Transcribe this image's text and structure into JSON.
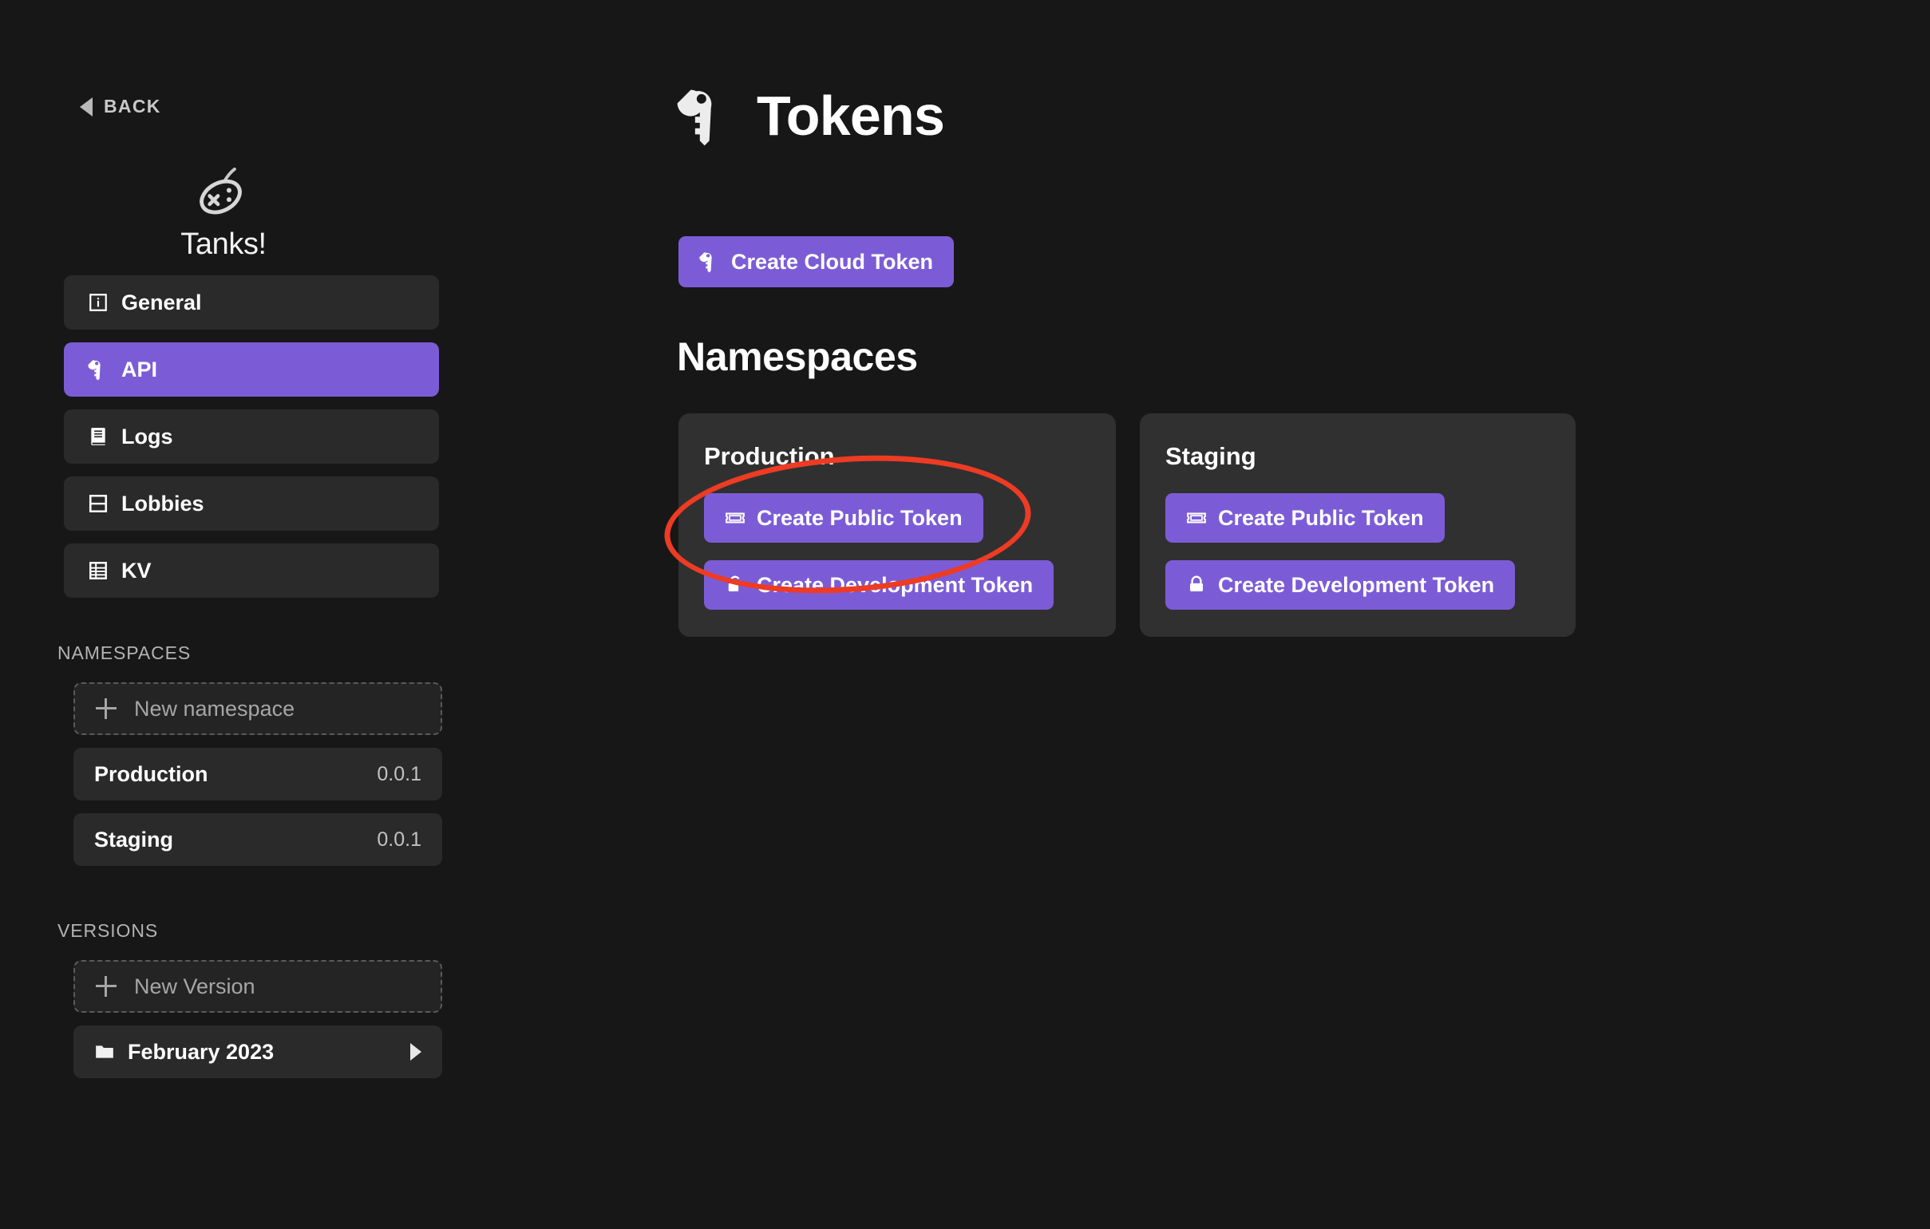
{
  "sidebar": {
    "back_label": "BACK",
    "back_icon": "triangle-left-icon",
    "game": {
      "name": "Tanks!",
      "icon": "gamepad-icon"
    },
    "nav": [
      {
        "label": "General",
        "icon": "info-square-icon",
        "active": false
      },
      {
        "label": "API",
        "icon": "key-icon",
        "active": true
      },
      {
        "label": "Logs",
        "icon": "book-icon",
        "active": false
      },
      {
        "label": "Lobbies",
        "icon": "window-icon",
        "active": false
      },
      {
        "label": "KV",
        "icon": "table-icon",
        "active": false
      }
    ],
    "namespaces": {
      "heading": "NAMESPACES",
      "new_label": "New namespace",
      "new_icon": "plus-icon",
      "items": [
        {
          "name": "Production",
          "version": "0.0.1"
        },
        {
          "name": "Staging",
          "version": "0.0.1"
        }
      ]
    },
    "versions": {
      "heading": "VERSIONS",
      "new_label": "New Version",
      "new_icon": "plus-icon",
      "items": [
        {
          "name": "February 2023",
          "icon": "folder-icon",
          "chevron": "chevron-right-icon"
        }
      ]
    }
  },
  "main": {
    "title": "Tokens",
    "title_icon": "key-icon",
    "cloud_token_button": {
      "label": "Create Cloud Token",
      "icon": "key-icon"
    },
    "namespaces_heading": "Namespaces",
    "cards": [
      {
        "title": "Production",
        "buttons": [
          {
            "label": "Create Public Token",
            "icon": "ticket-icon"
          },
          {
            "label": "Create Development Token",
            "icon": "lock-icon"
          }
        ]
      },
      {
        "title": "Staging",
        "buttons": [
          {
            "label": "Create Public Token",
            "icon": "ticket-icon"
          },
          {
            "label": "Create Development Token",
            "icon": "lock-icon"
          }
        ]
      }
    ]
  },
  "annotation": {
    "shape": "ellipse",
    "color": "#ed3b24",
    "target": "Production / Create Public Token"
  },
  "colors": {
    "background": "#171717",
    "surface": "#2a2a2a",
    "card": "#303030",
    "accent": "#7c5cd6",
    "annotation": "#ed3b24",
    "text": "#ffffff",
    "text_muted": "#b3b3b3"
  }
}
